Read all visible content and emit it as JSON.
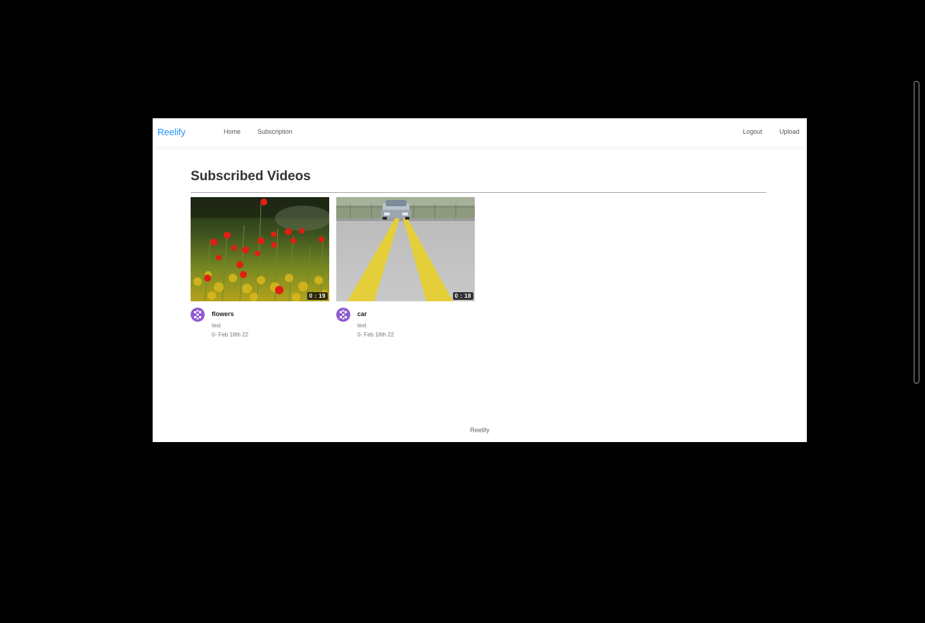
{
  "navbar": {
    "brand": "Reelify",
    "links": [
      "Home",
      "Subscription"
    ],
    "right_links": [
      "Logout",
      "Upload"
    ],
    "brand_color": "#1890ff"
  },
  "main": {
    "title": "Subscribed Videos",
    "videos": [
      {
        "title": "flowers",
        "author": "test",
        "date": "0- Feb 18th 22",
        "duration": "0 : 19",
        "thumbnail": "red-poppies-field"
      },
      {
        "title": "car",
        "author": "test",
        "date": "0- Feb 18th 22",
        "duration": "0 : 18",
        "thumbnail": "car-on-road-yellow-lines"
      }
    ]
  },
  "footer": {
    "text": "Reelify"
  },
  "colors": {
    "avatar": "#8e5ccf",
    "divider": "#a8a8a8"
  }
}
